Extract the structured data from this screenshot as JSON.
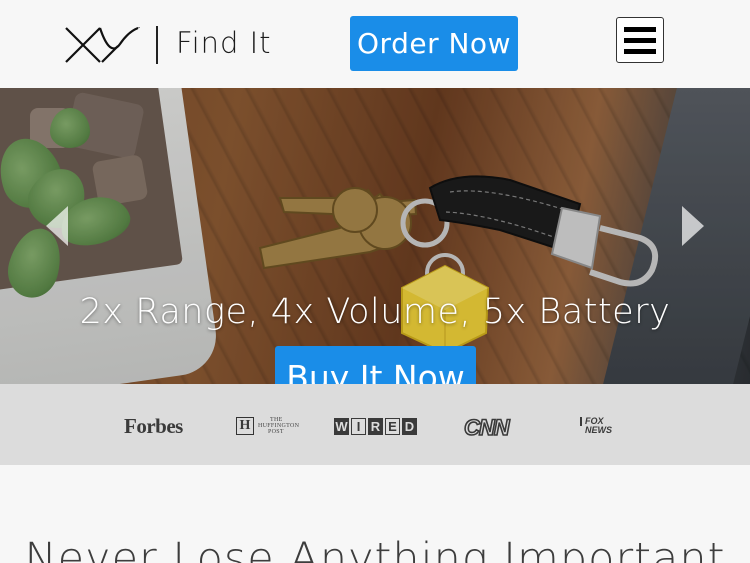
{
  "header": {
    "brand_text": "Find It",
    "order_button_label": "Order Now"
  },
  "hero": {
    "headline": "2x Range, 4x Volume, 5x Battery",
    "buy_button_label": "Buy It Now"
  },
  "press": {
    "forbes": "Forbes",
    "huffington_letter": "H",
    "huffington_text": [
      "THE",
      "HUFFINGTON",
      "POST"
    ],
    "wired": [
      "W",
      "I",
      "R",
      "E",
      "D"
    ],
    "cnn": "CNN",
    "fox": [
      "FOX",
      "NEWS"
    ]
  },
  "section": {
    "title": "Never Lose Anything Important"
  },
  "colors": {
    "accent": "#1a8de8",
    "press_bar": "#dcdcdc",
    "background": "#f7f7f7"
  },
  "icons": {
    "logo": "xy-logo",
    "menu": "hamburger-icon",
    "prev": "chevron-left-icon",
    "next": "chevron-right-icon"
  }
}
